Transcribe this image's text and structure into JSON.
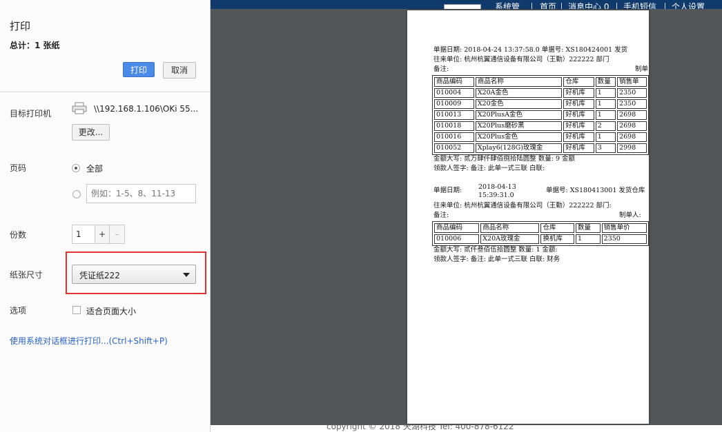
{
  "background_app": {
    "nav_items": [
      "系统管",
      "首页",
      "消息中心 0",
      "手机短信",
      "个人设置"
    ]
  },
  "footer": {
    "copyright": "copyright © 2018 天湖科技 Tel: 400-878-6122"
  },
  "dialog": {
    "title": "打印",
    "total": "总计：1 张纸",
    "print_button": "打印",
    "cancel_button": "取消",
    "destination": {
      "label": "目标打印机",
      "printer": "\\\\192.168.1.106\\OKi 55...",
      "change_button": "更改..."
    },
    "pages": {
      "label": "页码",
      "option_all": "全部",
      "custom_placeholder": "例如：1-5、8、11-13"
    },
    "copies": {
      "label": "份数",
      "value": "1",
      "plus": "+",
      "minus": "–"
    },
    "paper_size": {
      "label": "纸张尺寸",
      "value": "凭证纸222"
    },
    "options": {
      "label": "选项",
      "fit_to_page": "适合页面大小"
    },
    "system_dialog_link": "使用系统对话框进行打印...(Ctrl+Shift+P)"
  },
  "preview": {
    "doc1": {
      "line1": "单据日期:   2018-04-24 13:37:58.0  单据号:  XS180424001 发货",
      "line2": "往来单位:   杭州杭翼通信设备有限公司（王勤）222222    部门",
      "line3_left": "备注:",
      "line3_right": "制单",
      "headers": [
        "商品编码",
        "商品名称",
        "仓库",
        "数量",
        "销售单"
      ],
      "rows": [
        [
          "010004",
          "X20A金色",
          "好机库",
          "1",
          "2350"
        ],
        [
          "010009",
          "X20金色",
          "好机库",
          "1",
          "2350"
        ],
        [
          "010013",
          "X20PlusA金色",
          "好机库",
          "1",
          "2698"
        ],
        [
          "010018",
          "X20Plus磨砂黑",
          "好机库",
          "2",
          "2698"
        ],
        [
          "010016",
          "X20Plus金色",
          "好机库",
          "1",
          "2698"
        ],
        [
          "010052",
          "Xplay6(128G)玫瑰金",
          "好机库",
          "3",
          "2998"
        ]
      ],
      "foot1": "金额大写:   贰万肆仟肆佰捌拾陆圆整 数量:    9          金额",
      "foot2": "领款人签字:                             备注: 此单一式三联 白联:"
    },
    "doc2": {
      "date_label": "单据日期:",
      "date_value_1": "2018-04-13",
      "date_value_2": "15:39:31.0",
      "bill": "单据号:  XS180413001 发货仓库",
      "line2": "往来单位:   杭州杭翼通信设备有限公司（王勤）222222 部门:",
      "line3_left": "备注:",
      "line3_right": "制单人:",
      "headers": [
        "商品编码",
        "商品名称",
        "仓库",
        "数量",
        "销售单价"
      ],
      "rows": [
        [
          "010006",
          "X20A玫瑰金",
          "换机库",
          "1",
          "2350"
        ]
      ],
      "foot1": "金额大写:   贰仟叁佰伍拾圆整    数量:    1              金额:",
      "foot2": "领款人签字:                       备注: 此单一式三联 白联: 财务"
    }
  }
}
